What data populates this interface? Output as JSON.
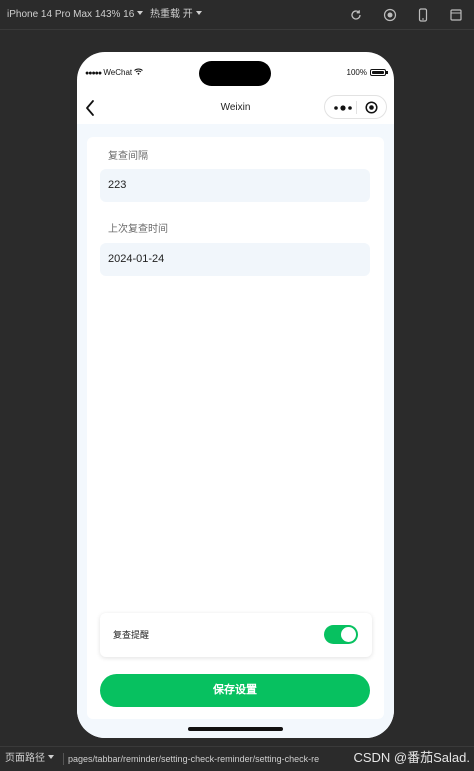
{
  "toolbar": {
    "device": "iPhone 14 Pro Max 143% 16",
    "hot_reload": "热重载 开"
  },
  "status_bar": {
    "carrier": "WeChat",
    "battery": "100%"
  },
  "nav": {
    "title": "Weixin"
  },
  "form": {
    "interval_label": "复查间隔",
    "interval_value": "223",
    "last_check_label": "上次复查时间",
    "last_check_value": "2024-01-24",
    "reminder_label": "复查提醒",
    "reminder_on": true,
    "save_label": "保存设置"
  },
  "footer": {
    "path_label": "页面路径",
    "path": "pages/tabbar/reminder/setting-check-reminder/setting-check-re",
    "watermark": "CSDN @番茄Salad."
  },
  "colors": {
    "accent": "#07c160",
    "page_background": "#f3f8fd",
    "input_background": "#f1f6fb"
  }
}
